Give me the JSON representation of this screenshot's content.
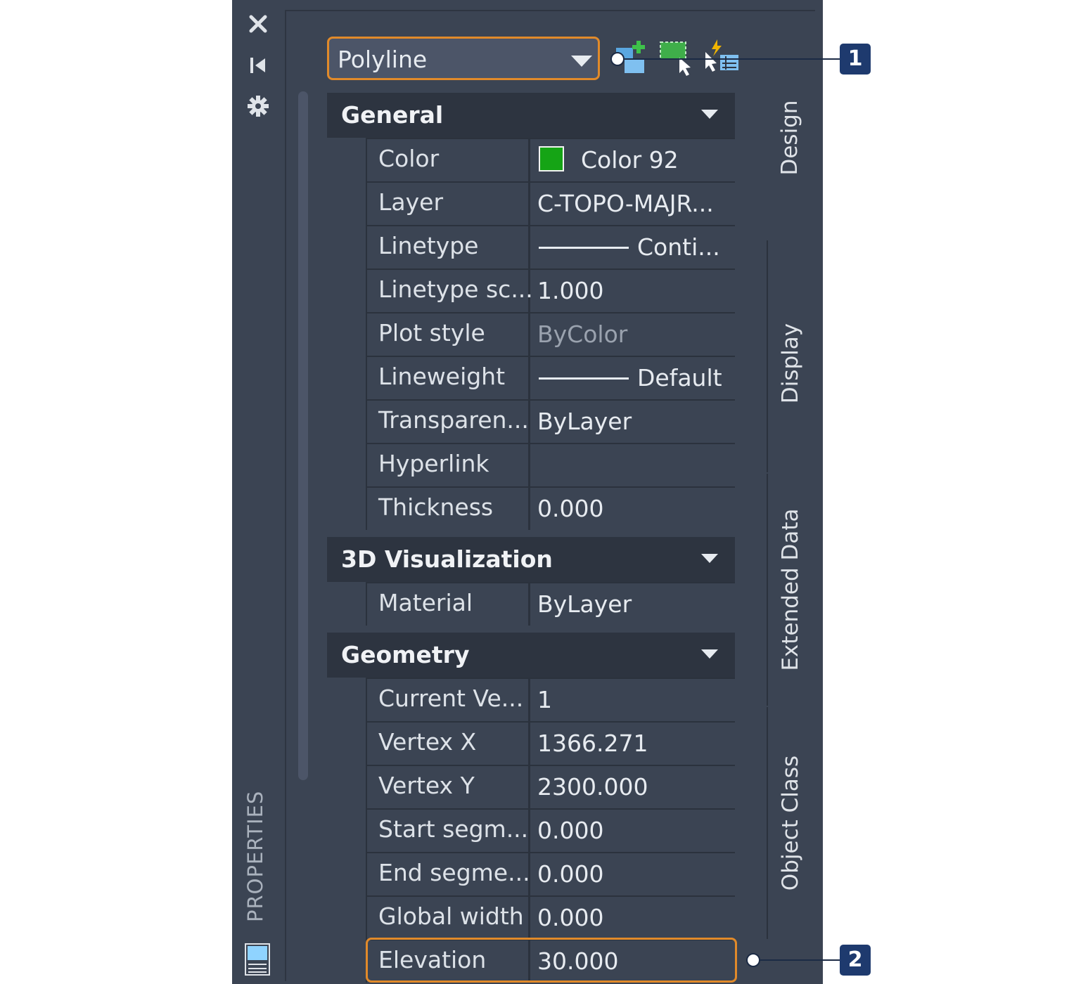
{
  "palette": {
    "title": "PROPERTIES",
    "object_type": "Polyline"
  },
  "sections": [
    {
      "label": "General",
      "rows": [
        {
          "name": "Color",
          "value": "Color 92",
          "swatch_color": "#15a415"
        },
        {
          "name": "Layer",
          "value": "C-TOPO-MAJR..."
        },
        {
          "name": "Linetype",
          "value": "Conti..."
        },
        {
          "name": "Linetype  sc...",
          "value": "1.000"
        },
        {
          "name": "Plot style",
          "value": "ByColor"
        },
        {
          "name": "Lineweight",
          "value": "Default"
        },
        {
          "name": "Transparen...",
          "value": "ByLayer"
        },
        {
          "name": "Hyperlink",
          "value": ""
        },
        {
          "name": "Thickness",
          "value": "0.000"
        }
      ]
    },
    {
      "label": "3D Visualization",
      "rows": [
        {
          "name": "Material",
          "value": "ByLayer"
        }
      ]
    },
    {
      "label": "Geometry",
      "rows": [
        {
          "name": "Current  Ve...",
          "value": "1"
        },
        {
          "name": "Vertex X",
          "value": "1366.271"
        },
        {
          "name": "Vertex Y",
          "value": "2300.000"
        },
        {
          "name": "Start  segm...",
          "value": "0.000"
        },
        {
          "name": "End  segme...",
          "value": "0.000"
        },
        {
          "name": "Global width",
          "value": "0.000"
        },
        {
          "name": "Elevation",
          "value": "30.000"
        }
      ]
    }
  ],
  "tabs": [
    "Design",
    "Display",
    "Extended Data",
    "Object Class"
  ],
  "callouts": [
    "1",
    "2"
  ],
  "colors": {
    "panel_bg": "#3b4453",
    "section_bg": "#2d3440",
    "highlight": "#e18a2a",
    "callout_badge": "#1e3a6e",
    "swatch": "#15a415"
  },
  "icons": [
    "close-icon",
    "auto-hide-icon",
    "settings-icon",
    "quick-select-icon",
    "select-objects-icon",
    "toggle-pickadd-icon",
    "properties-palette-icon"
  ]
}
